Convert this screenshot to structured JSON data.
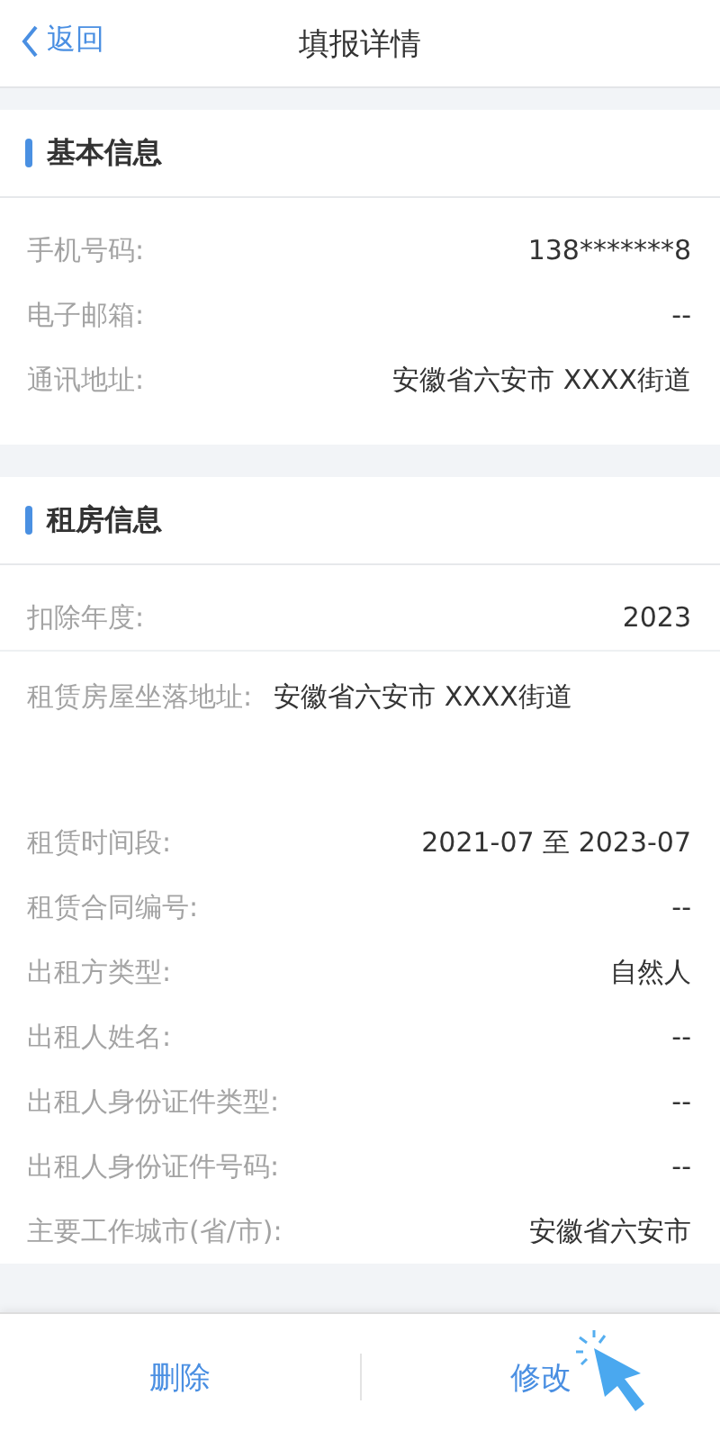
{
  "nav": {
    "back": "返回",
    "title": "填报详情"
  },
  "sections": [
    {
      "title": "基本信息",
      "groups": [
        [
          {
            "kind": "pair",
            "label": "手机号码:",
            "value": "138*******8"
          },
          {
            "kind": "pair",
            "label": "电子邮箱:",
            "value": "--"
          },
          {
            "kind": "pair",
            "label": "通讯地址:",
            "value": "安徽省六安市 XXXX街道"
          }
        ]
      ]
    },
    {
      "title": "租房信息",
      "groups": [
        [
          {
            "kind": "pair",
            "label": "扣除年度:",
            "value": "2023"
          }
        ],
        [
          {
            "kind": "inline",
            "label": "租赁房屋坐落地址:",
            "value": "安徽省六安市 XXXX街道"
          },
          {
            "kind": "pair",
            "label": "租赁时间段:",
            "value": "2021-07 至 2023-07"
          },
          {
            "kind": "pair",
            "label": "租赁合同编号:",
            "value": "--"
          },
          {
            "kind": "pair",
            "label": "出租方类型:",
            "value": "自然人"
          },
          {
            "kind": "pair",
            "label": "出租人姓名:",
            "value": "--"
          },
          {
            "kind": "pair",
            "label": "出租人身份证件类型:",
            "value": "--"
          },
          {
            "kind": "pair",
            "label": "出租人身份证件号码:",
            "value": "--"
          },
          {
            "kind": "pair",
            "label": "主要工作城市(省/市):",
            "value": "安徽省六安市"
          }
        ]
      ]
    }
  ],
  "footer": {
    "buttons": [
      "删除",
      "修改"
    ]
  }
}
